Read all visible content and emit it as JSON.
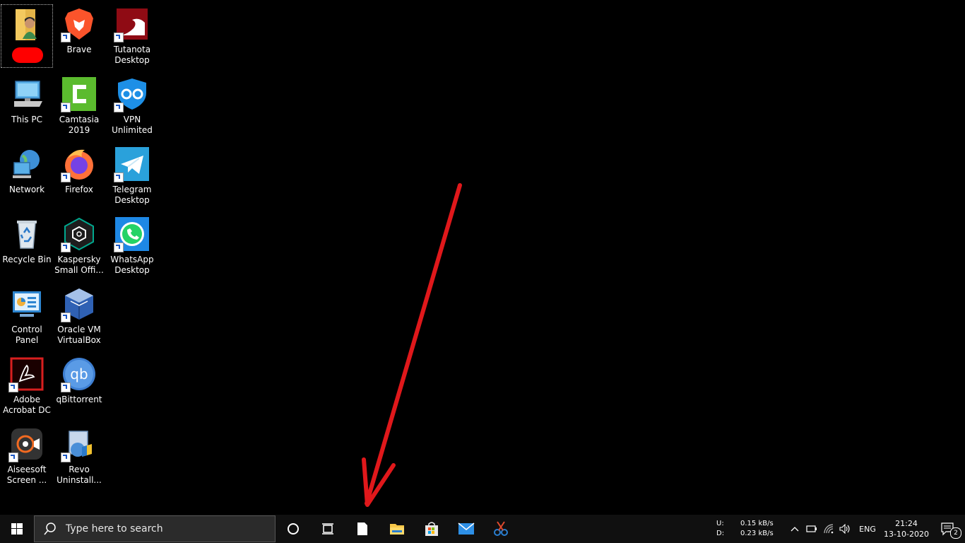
{
  "desktop": {
    "icons": [
      {
        "label": "",
        "icon": "user-folder-icon"
      },
      {
        "label": "Brave",
        "icon": "brave-icon"
      },
      {
        "label": "Tutanota Desktop",
        "icon": "tutanota-icon"
      },
      {
        "label": "This PC",
        "icon": "this-pc-icon"
      },
      {
        "label": "Camtasia 2019",
        "icon": "camtasia-icon"
      },
      {
        "label": "VPN Unlimited",
        "icon": "vpn-icon"
      },
      {
        "label": "Network",
        "icon": "network-icon"
      },
      {
        "label": "Firefox",
        "icon": "firefox-icon"
      },
      {
        "label": "Telegram Desktop",
        "icon": "telegram-icon"
      },
      {
        "label": "Recycle Bin",
        "icon": "recycle-bin-icon"
      },
      {
        "label": "Kaspersky Small Offi...",
        "icon": "kaspersky-icon"
      },
      {
        "label": "WhatsApp Desktop",
        "icon": "whatsapp-icon"
      },
      {
        "label": "Control Panel",
        "icon": "control-panel-icon"
      },
      {
        "label": "Oracle VM VirtualBox",
        "icon": "virtualbox-icon"
      },
      {
        "label": "Adobe Acrobat DC",
        "icon": "acrobat-icon"
      },
      {
        "label": "qBittorrent",
        "icon": "qbittorrent-icon"
      },
      {
        "label": "Aiseesoft Screen ...",
        "icon": "aiseesoft-icon"
      },
      {
        "label": "Revo Uninstall...",
        "icon": "revo-icon"
      }
    ]
  },
  "taskbar": {
    "search_placeholder": "Type here to search",
    "net_upload_label": "U:",
    "net_download_label": "D:",
    "net_upload_speed": "0.15 kB/s",
    "net_download_speed": "0.23 kB/s",
    "language": "ENG",
    "time": "21:24",
    "date": "13-10-2020",
    "notification_count": "2"
  },
  "colors": {
    "annotation_arrow": "#e0181b",
    "taskbar_bg": "#101010"
  }
}
